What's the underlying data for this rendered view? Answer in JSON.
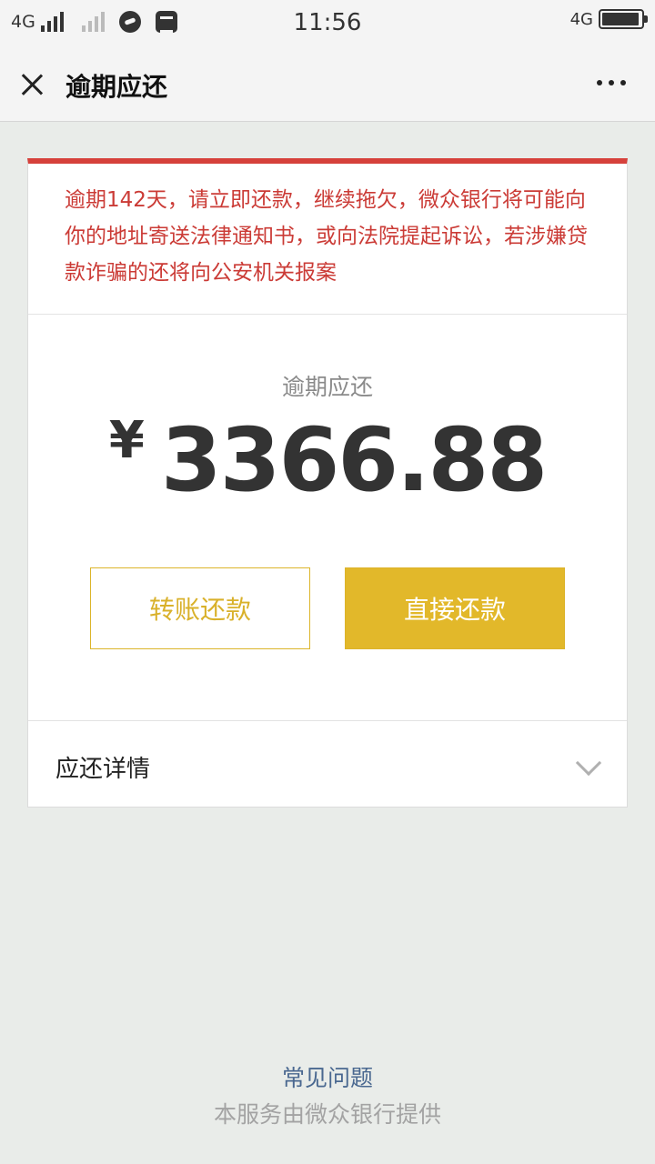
{
  "status_bar": {
    "network_left": "4G",
    "time": "11:56",
    "network_right": "4G",
    "battery_level": 0.95
  },
  "nav": {
    "title": "逾期应还"
  },
  "card": {
    "warning_text": "逾期142天，请立即还款，继续拖欠，微众银行将可能向你的地址寄送法律通知书，或向法院提起诉讼，若涉嫌贷款诈骗的还将向公安机关报案",
    "amount_label": "逾期应还",
    "currency_symbol": "¥",
    "amount_value": "3366.88",
    "transfer_button": "转账还款",
    "direct_button": "直接还款",
    "details_label": "应还详情"
  },
  "footer": {
    "faq_link": "常见问题",
    "provider_text": "本服务由微众银行提供"
  },
  "colors": {
    "warning_red": "#d6413b",
    "accent_gold": "#e2b82a",
    "link_blue": "#4a6890"
  }
}
